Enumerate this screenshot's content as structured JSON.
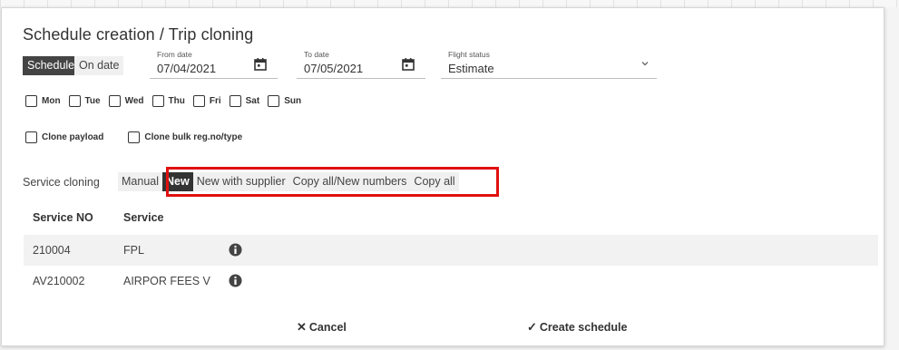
{
  "dialog": {
    "title": "Schedule creation / Trip cloning"
  },
  "mode_toggle": {
    "schedule_label": "Schedule",
    "on_date_label": "On date",
    "selected": "Schedule"
  },
  "from_date": {
    "label": "From date",
    "value": "07/04/2021",
    "icon": "calendar-icon"
  },
  "to_date": {
    "label": "To date",
    "value": "07/05/2021",
    "icon": "calendar-icon"
  },
  "flight_status": {
    "label": "Flight status",
    "value": "Estimate",
    "icon": "chevron-down-icon"
  },
  "weekdays": [
    {
      "label": "Mon",
      "checked": false
    },
    {
      "label": "Tue",
      "checked": false
    },
    {
      "label": "Wed",
      "checked": false
    },
    {
      "label": "Thu",
      "checked": false
    },
    {
      "label": "Fri",
      "checked": false
    },
    {
      "label": "Sat",
      "checked": false
    },
    {
      "label": "Sun",
      "checked": false
    }
  ],
  "options": {
    "clone_payload": {
      "label": "Clone payload",
      "checked": false
    },
    "clone_bulk": {
      "label": "Clone bulk reg.no/type",
      "checked": false
    }
  },
  "service_cloning": {
    "label": "Service cloning",
    "choices": [
      "Manual",
      "New",
      "New with supplier",
      "Copy all/New numbers",
      "Copy all"
    ],
    "selected": "New"
  },
  "services_table": {
    "headers": [
      "Service NO",
      "Service"
    ],
    "rows": [
      {
        "service_no": "210004",
        "service": "FPL",
        "icon": "info-icon"
      },
      {
        "service_no": "AV210002",
        "service": "AIRPOR FEES V",
        "icon": "info-icon"
      }
    ]
  },
  "footer": {
    "cancel_label": "Cancel",
    "create_label": "Create schedule"
  },
  "colors": {
    "active_bg": "#444444",
    "highlight_border": "#e01010"
  }
}
